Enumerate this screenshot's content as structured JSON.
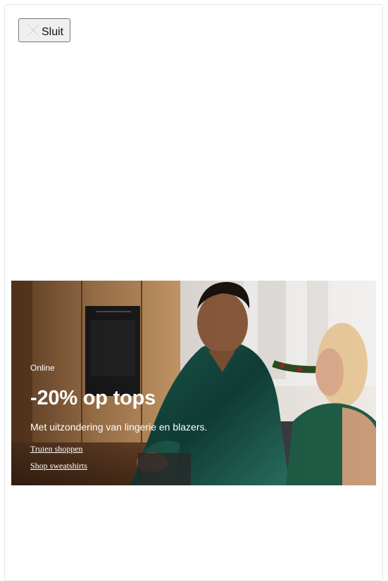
{
  "close_button": {
    "label": "Sluit",
    "icon": "close-icon"
  },
  "promo": {
    "eyebrow": "Online",
    "headline": "-20% op tops",
    "subline": "Met uitzondering van lingerie en blazers.",
    "links": [
      {
        "label": "Truien shoppen"
      },
      {
        "label": "Shop sweatshirts"
      }
    ],
    "image": "two-women-laughing-in-kitchen-photo"
  },
  "colors": {
    "text_on_image": "#ffffff",
    "button_bg": "#efefef",
    "button_border": "#767676"
  }
}
